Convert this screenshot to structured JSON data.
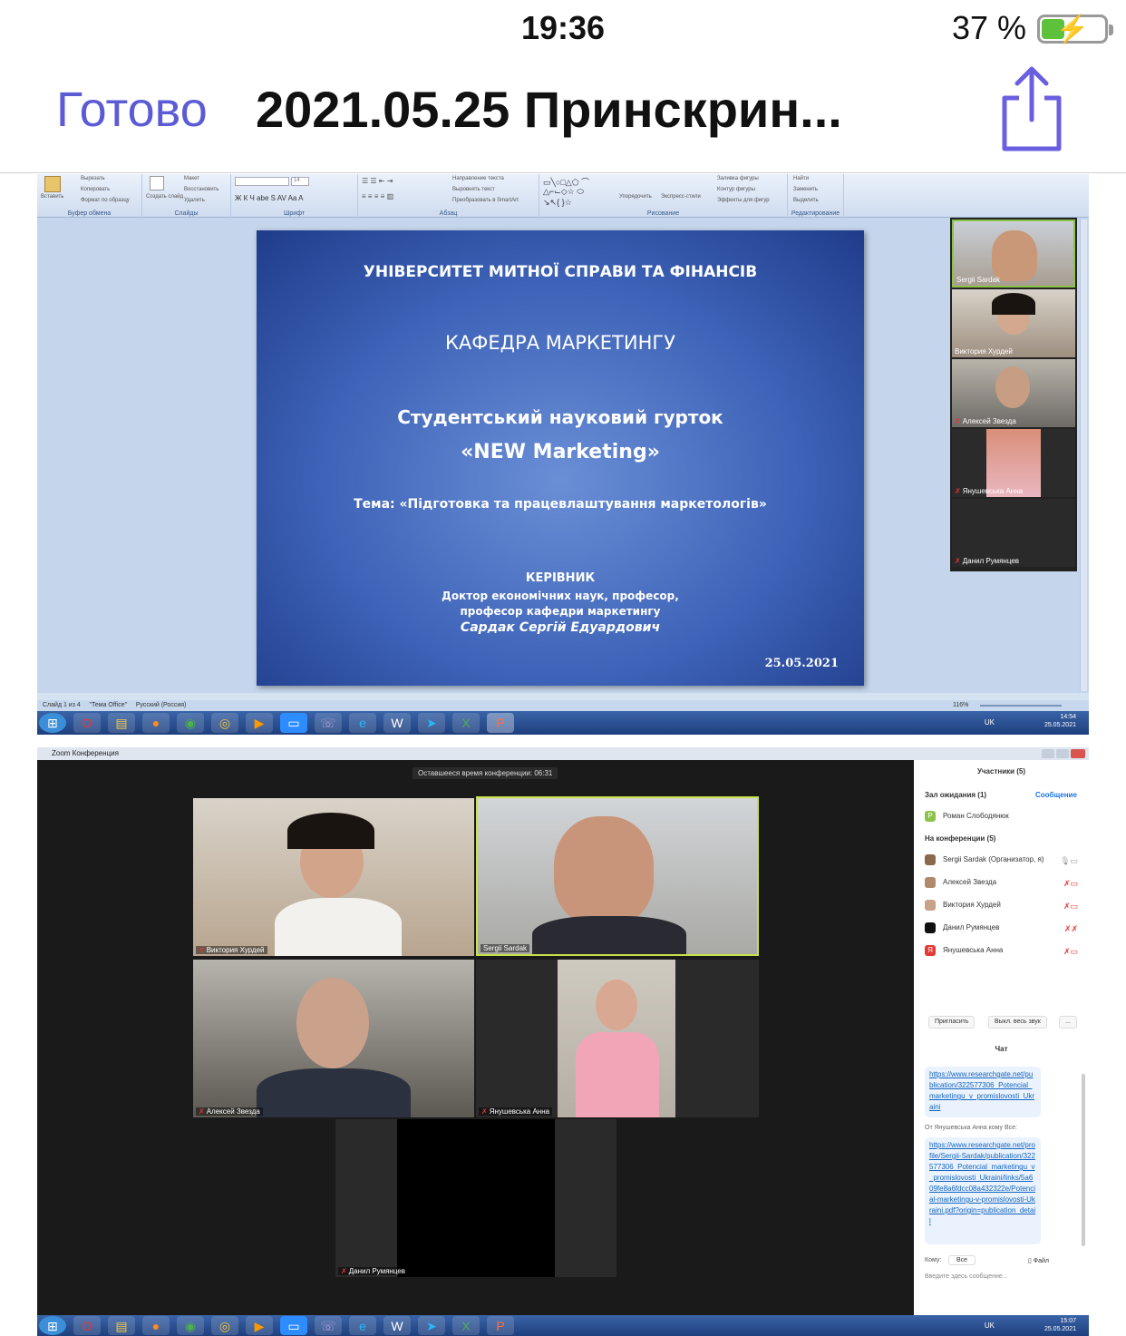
{
  "status_bar": {
    "time": "19:36",
    "battery": "37 %",
    "battery_level": 0.37
  },
  "nav": {
    "done": "Готово",
    "title": "2021.05.25 Принскрин..."
  },
  "powerpoint": {
    "ribbon": {
      "clipboard": {
        "paste": "Вставить",
        "cut": "Вырезать",
        "copy": "Копировать",
        "format": "Формат по образцу",
        "label": "Буфер обмена"
      },
      "slides": {
        "new": "Создать слайд",
        "layout": "Макет",
        "reset": "Восстановить",
        "delete": "Удалить",
        "label": "Слайды"
      },
      "font": {
        "size": "14",
        "label": "Шрифт"
      },
      "paragraph": {
        "direction": "Направление текста",
        "align": "Выровнять текст",
        "smartart": "Преобразовать в SmartArt",
        "label": "Абзац"
      },
      "drawing": {
        "arrange": "Упорядочить",
        "styles": "Экспресс-стили",
        "fill": "Заливка фигуры",
        "outline": "Контур фигуры",
        "effects": "Эффекты для фигур",
        "label": "Рисование"
      },
      "editing": {
        "find": "Найти",
        "replace": "Заменить",
        "select": "Выделить",
        "label": "Редактирование"
      }
    },
    "slide": {
      "university": "УНІВЕРСИТЕТ МИТНОЇ СПРАВИ ТА ФІНАНСІВ",
      "department": "КАФЕДРА МАРКЕТИНГУ",
      "circle_line1": "Студентський науковий гурток",
      "circle_line2": "«NEW Marketing»",
      "topic": "Тема: «Підготовка та працевлаштування маркетологів»",
      "supervisor_heading": "КЕРІВНИК",
      "supervisor_line1": "Доктор економічних наук, професор,",
      "supervisor_line2": "професор  кафедри маркетингу",
      "supervisor_name": "Сардак Сергій Едуардович",
      "date": "25.05.2021"
    },
    "participants": [
      "Sergii Sardak",
      "Виктория  Хурдей",
      "Алексей Звезда",
      "Янушевська Анна",
      "Данил Румянцев"
    ],
    "statusbar": {
      "slide": "Слайд 1 из 4",
      "theme": "\"Тема Office\"",
      "language": "Русский (Россия)",
      "zoom": "116%"
    },
    "tray": {
      "lang": "UK",
      "time": "14:54",
      "date": "25.05.2021"
    }
  },
  "zoom": {
    "window_title": "Zoom Конференция",
    "remaining": "Оставшееся время конференции: 06:31",
    "tiles": [
      {
        "name": "Виктория  Хурдей",
        "muted": true
      },
      {
        "name": "Sergii Sardak",
        "muted": false
      },
      {
        "name": "Алексей Звезда",
        "muted": true
      },
      {
        "name": "Янушевська Анна",
        "muted": true
      },
      {
        "name": "Данил Румянцев",
        "muted": true
      }
    ],
    "panel": {
      "title": "Участники (5)",
      "waiting_heading": "Зал ожидания (1)",
      "message_link": "Сообщение",
      "waiting_person": "Роман Слободянюк",
      "waiting_initial": "Р",
      "in_meeting_heading": "На конференции (5)",
      "members": [
        {
          "name": "Sergii Sardak (Организатор, я)",
          "avatar_color": "#8a6a4a"
        },
        {
          "name": "Алексей Звезда",
          "avatar_color": "#b08a6a"
        },
        {
          "name": "Виктория  Хурдей",
          "avatar_color": "#c9a28a"
        },
        {
          "name": "Данил Румянцев",
          "avatar_color": "#111111"
        },
        {
          "name": "Янушевська Анна",
          "avatar_color": "#e53935",
          "initial": "Я"
        }
      ],
      "invite": "Пригласить",
      "mute_all": "Выкл. весь звук",
      "more": "...",
      "chat_title": "Чат",
      "chat_msg1": "https://www.researchgate.net/publication/322577306_Potencial_marketingu_v_promislovosti_Ukraini",
      "chat_from": "От Янушевська Анна кому Все:",
      "chat_msg2": "https://www.researchgate.net/profile/Sergii-Sardak/publication/322577306_Potencial_marketingu_v_promislovosti_Ukraini/links/5a609fe8a6fdcc08a432322e/Potencial-marketingu-v-promislovosti-Ukraini.pdf?origin=publication_detail",
      "to_label": "Кому:",
      "to_value": "Все",
      "file": "Файл",
      "placeholder": "Введите здесь сообщение..."
    },
    "tray": {
      "lang": "UK",
      "time": "15:07",
      "date": "25.05.2021"
    }
  }
}
